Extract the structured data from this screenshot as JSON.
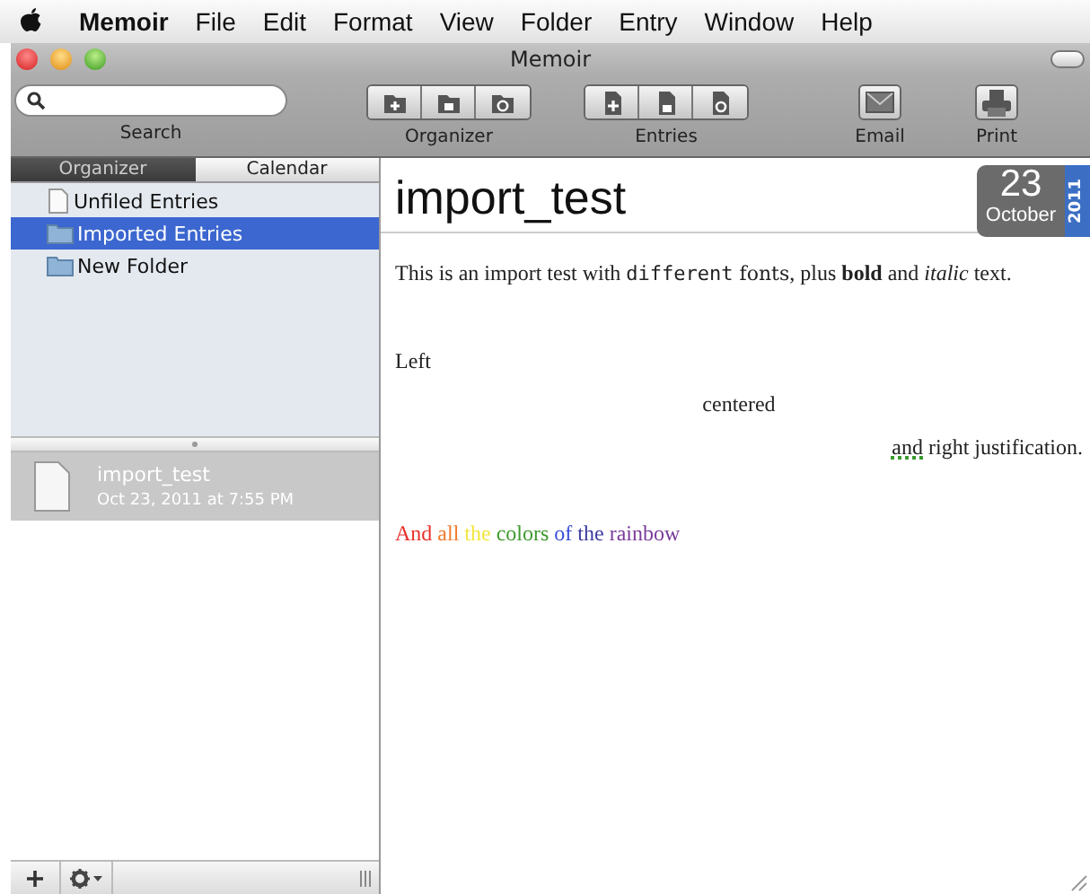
{
  "menu_bar": {
    "items": [
      {
        "label": "Memoir",
        "kind": "app"
      },
      {
        "label": "File",
        "kind": "menu"
      },
      {
        "label": "Edit",
        "kind": "menu"
      },
      {
        "label": "Format",
        "kind": "menu"
      },
      {
        "label": "View",
        "kind": "menu"
      },
      {
        "label": "Folder",
        "kind": "menu"
      },
      {
        "label": "Entry",
        "kind": "menu"
      },
      {
        "label": "Window",
        "kind": "menu"
      },
      {
        "label": "Help",
        "kind": "menu"
      }
    ]
  },
  "window": {
    "title": "Memoir"
  },
  "toolbar": {
    "search": {
      "label": "Search"
    },
    "items": [
      {
        "kind": "folders",
        "label": "Organizer"
      },
      {
        "kind": "entries",
        "label": "Entries"
      },
      {
        "kind": "email",
        "label": "Email"
      },
      {
        "kind": "print",
        "label": "Print"
      }
    ]
  },
  "sidebar": {
    "tabs": [
      {
        "label": "Organizer",
        "selected": true
      },
      {
        "label": "Calendar",
        "selected": false
      }
    ],
    "folders": [
      {
        "label": "Unfiled Entries",
        "kind": "document",
        "selected": false
      },
      {
        "label": "Imported Entries",
        "kind": "folder",
        "selected": true
      },
      {
        "label": "New Folder",
        "kind": "folder",
        "selected": false
      }
    ],
    "entries": [
      {
        "title": "import_test",
        "date": "Oct 23, 2011 at 7:55 PM",
        "selected": true
      }
    ]
  },
  "entry": {
    "title": "import_test",
    "day": "23",
    "month": "October",
    "year": "2011",
    "blocks": [
      [
        {
          "kind": "left",
          "runs": [
            {
              "text": "This is an import test with ",
              "kind": "plain"
            },
            {
              "text": "different",
              "kind": "mono"
            },
            {
              "text": " fonts",
              "kind": "alt"
            },
            {
              "text": ", plus ",
              "kind": "plain"
            },
            {
              "text": "bold",
              "kind": "bold"
            },
            {
              "text": " and ",
              "kind": "plain"
            },
            {
              "text": "italic",
              "kind": "italic"
            },
            {
              "text": " text.",
              "kind": "plain"
            }
          ]
        }
      ],
      [
        {
          "kind": "left",
          "runs": [
            {
              "text": "Left",
              "kind": "plain"
            }
          ]
        },
        {
          "kind": "center",
          "runs": [
            {
              "text": "centered",
              "kind": "plain"
            }
          ]
        },
        {
          "kind": "right",
          "runs": [
            {
              "text": "and",
              "kind": "plain",
              "misspelled": true
            },
            {
              "text": " right justification.",
              "kind": "plain"
            }
          ]
        }
      ],
      [
        {
          "kind": "left",
          "runs": [
            {
              "text": "And ",
              "kind": "plain",
              "color": "#e8302a"
            },
            {
              "text": "all ",
              "kind": "plain",
              "color": "#f07a2c"
            },
            {
              "text": "the ",
              "kind": "plain",
              "color": "#f2e640"
            },
            {
              "text": "colors ",
              "kind": "plain",
              "color": "#3e9a2e"
            },
            {
              "text": "of ",
              "kind": "plain",
              "color": "#3a4fd8"
            },
            {
              "text": "the ",
              "kind": "plain",
              "color": "#3c3aa0"
            },
            {
              "text": "rainbow",
              "kind": "plain",
              "color": "#7a3c9a"
            }
          ]
        }
      ]
    ]
  }
}
